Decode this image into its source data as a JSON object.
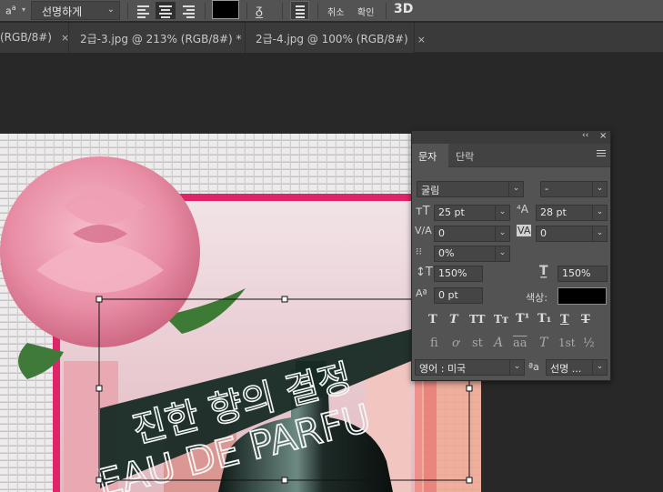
{
  "options_bar": {
    "antialias_icon": "aa-icon",
    "antialias_label_a": "a",
    "antialias_label_b": "a",
    "antialias_value": "선명하게",
    "color_hex": "#000000",
    "cancel_label": "취소",
    "commit_label": "확인",
    "three_d_label": "3D"
  },
  "document_tabs": [
    {
      "label": "(RGB/8#)",
      "close": "×"
    },
    {
      "label": "2급-3.jpg @ 213% (RGB/8#) *",
      "close": "×"
    },
    {
      "label": "2급-4.jpg @ 100% (RGB/8#)",
      "close": "×"
    }
  ],
  "artwork": {
    "text_line_1": "진한 향의 결정",
    "text_line_2": "EAU DE PARFUM",
    "text_line_2_visible": "EAU DE PARFU"
  },
  "character_panel": {
    "collapse_glyph": "‹‹",
    "close_glyph": "×",
    "tabs": [
      {
        "label": "문자",
        "active": true
      },
      {
        "label": "단락",
        "active": false
      }
    ],
    "font_family": "굴림",
    "font_style": "-",
    "font_size": "25 pt",
    "leading": "28 pt",
    "kerning": "0",
    "tracking": "0",
    "tsume": "0%",
    "vertical_scale": "150%",
    "horizontal_scale": "150%",
    "baseline_shift": "0 pt",
    "color_label": "색상:",
    "color_hex": "#000000",
    "style_buttons": [
      "T",
      "T",
      "TT",
      "Tт",
      "T¹",
      "T₁",
      "T",
      "T"
    ],
    "opentype_buttons": [
      "fi",
      "ơ",
      "st",
      "A",
      "aa",
      "T",
      "1st",
      "½"
    ],
    "language": "영어 : 미국",
    "aa_label": "ªa",
    "antialias": "선명 ..."
  }
}
